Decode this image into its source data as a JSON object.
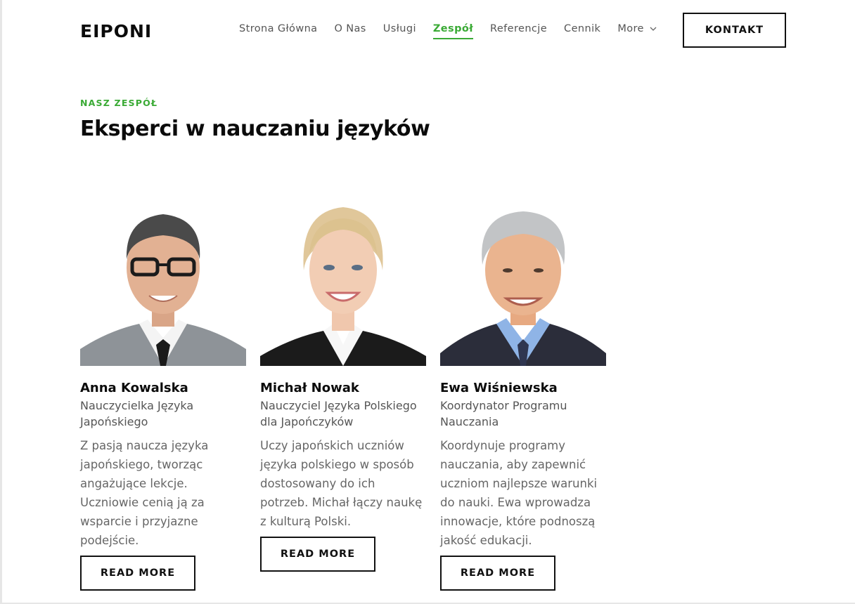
{
  "brand": {
    "logo": "EIPONI",
    "accent": "#3aaa35"
  },
  "nav": {
    "items": [
      {
        "label": "Strona Główna",
        "active": false
      },
      {
        "label": "O Nas",
        "active": false
      },
      {
        "label": "Usługi",
        "active": false
      },
      {
        "label": "Zespół",
        "active": true
      },
      {
        "label": "Referencje",
        "active": false
      },
      {
        "label": "Cennik",
        "active": false
      }
    ],
    "more_label": "More",
    "contact_label": "KONTAKT"
  },
  "section": {
    "eyebrow": "NASZ ZESPÓŁ",
    "title": "Eksperci w nauczaniu języków"
  },
  "team": [
    {
      "name": "Anna Kowalska",
      "role": "Nauczycielka Języka Japońskiego",
      "description": "Z pasją naucza języka japońskiego, tworząc angażujące lekcje. Uczniowie cenią ją za wsparcie i przyjazne podejście.",
      "button": "READ MORE",
      "photo_icon": "portrait-man-glasses"
    },
    {
      "name": "Michał Nowak",
      "role": "Nauczyciel Języka Polskiego dla Japończyków",
      "description": "Uczy japońskich uczniów języka polskiego w sposób dostosowany do ich potrzeb. Michał łączy naukę z kulturą Polski.",
      "button": "READ MORE",
      "photo_icon": "portrait-woman-blonde"
    },
    {
      "name": "Ewa Wiśniewska",
      "role": "Koordynator Programu Nauczania",
      "description": "Koordynuje programy nauczania, aby zapewnić uczniom najlepsze warunki do nauki. Ewa wprowadza innowacje, które podnoszą jakość edukacji.",
      "button": "READ MORE",
      "photo_icon": "portrait-man-grey-hair"
    }
  ]
}
